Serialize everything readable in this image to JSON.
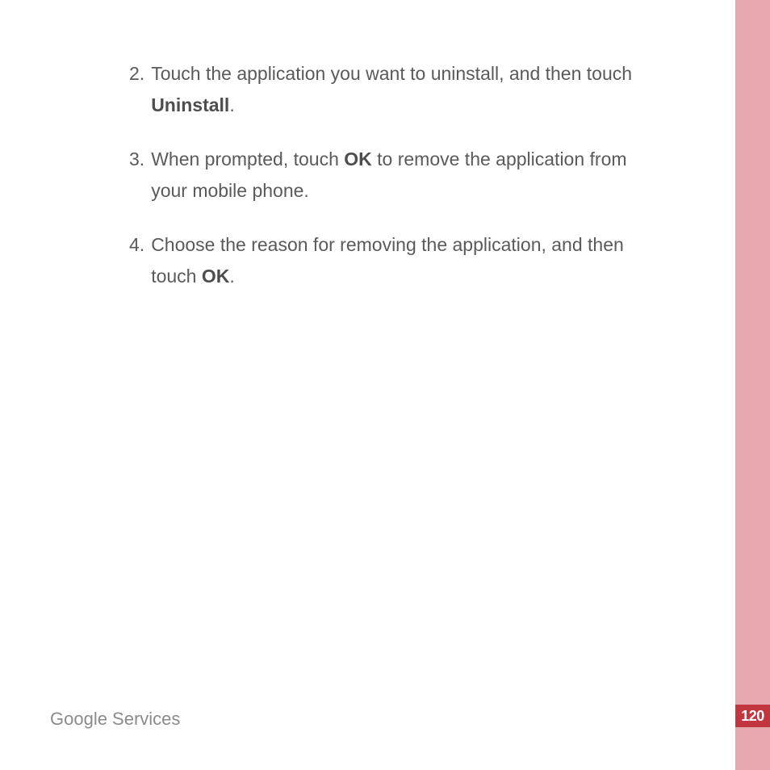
{
  "steps": [
    {
      "number": "2.",
      "text_before_bold1": "Touch the application you want to uninstall, and then touch ",
      "bold1": "Uninstall",
      "text_after_bold1": "."
    },
    {
      "number": "3.",
      "text_before_bold1": "When prompted, touch ",
      "bold1": "OK",
      "text_after_bold1": " to remove the application from your mobile phone."
    },
    {
      "number": "4.",
      "text_before_bold1": "Choose the reason for removing the application, and then touch ",
      "bold1": "OK",
      "text_after_bold1": "."
    }
  ],
  "footer": {
    "section_title": "Google Services"
  },
  "page_number": "120"
}
